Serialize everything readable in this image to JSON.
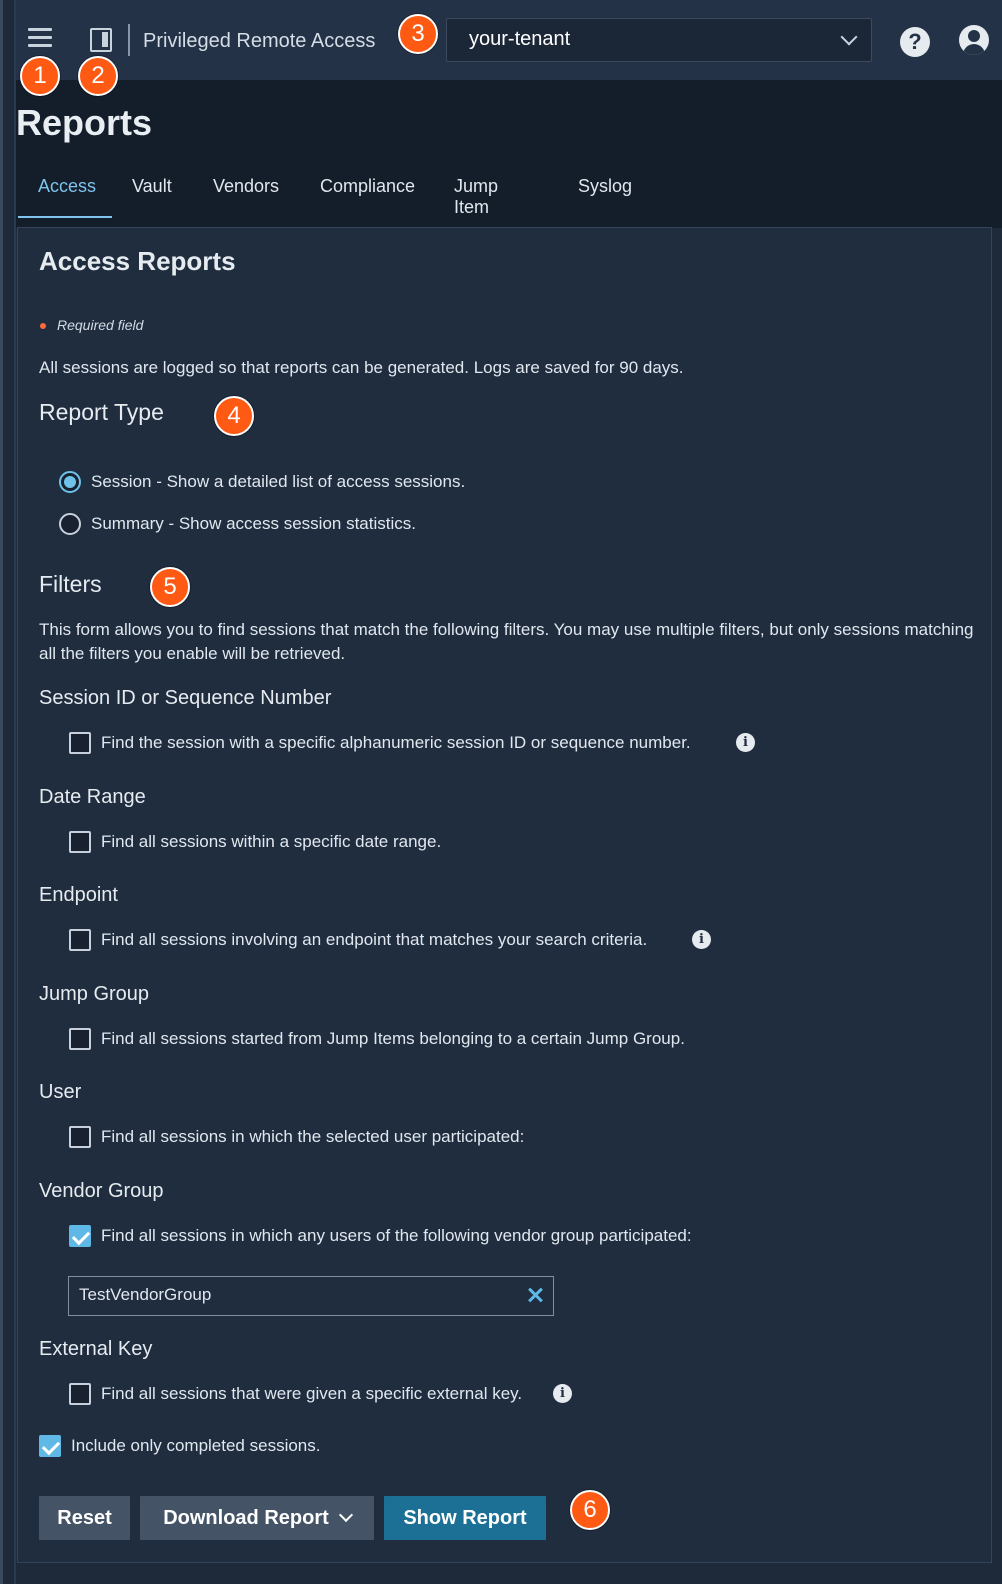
{
  "topbar": {
    "app_title": "Privileged Remote Access",
    "tenant": "your-tenant",
    "icons": [
      "menu-icon",
      "panel-icon",
      "chevron-down-icon",
      "help-icon",
      "user-icon"
    ]
  },
  "page": {
    "title": "Reports",
    "tabs": [
      {
        "label": "Access",
        "active": true
      },
      {
        "label": "Vault",
        "active": false
      },
      {
        "label": "Vendors",
        "active": false
      },
      {
        "label": "Compliance",
        "active": false
      },
      {
        "label": "Jump Item",
        "active": false
      },
      {
        "label": "Syslog",
        "active": false
      }
    ]
  },
  "form": {
    "heading": "Access Reports",
    "required_note": "Required field",
    "intro": "All sessions are logged so that reports can be generated. Logs are saved for 90 days.",
    "report_type": {
      "heading": "Report Type",
      "options": [
        {
          "label": "Session - Show a detailed list of access sessions.",
          "checked": true
        },
        {
          "label": "Summary - Show access session statistics.",
          "checked": false
        }
      ]
    },
    "filters": {
      "heading": "Filters",
      "description": "This form allows you to find sessions that match the following filters. You may use multiple filters, but only sessions matching all the filters you enable will be retrieved.",
      "groups": [
        {
          "title": "Session ID or Sequence Number",
          "label": "Find the session with a specific alphanumeric session ID or sequence number.",
          "checked": false,
          "info": true
        },
        {
          "title": "Date Range",
          "label": "Find all sessions within a specific date range.",
          "checked": false,
          "info": false
        },
        {
          "title": "Endpoint",
          "label": "Find all sessions involving an endpoint that matches your search criteria.",
          "checked": false,
          "info": true
        },
        {
          "title": "Jump Group",
          "label": "Find all sessions started from Jump Items belonging to a certain Jump Group.",
          "checked": false,
          "info": false
        },
        {
          "title": "User",
          "label": "Find all sessions in which the selected user participated:",
          "checked": false,
          "info": false
        },
        {
          "title": "Vendor Group",
          "label": "Find all sessions in which any users of the following vendor group participated:",
          "checked": true,
          "info": false,
          "value": "TestVendorGroup"
        },
        {
          "title": "External Key",
          "label": "Find all sessions that were given a specific external key.",
          "checked": false,
          "info": true
        }
      ],
      "completed_only": {
        "label": "Include only completed sessions.",
        "checked": true
      }
    },
    "buttons": {
      "reset": "Reset",
      "download": "Download Report",
      "show": "Show Report"
    }
  },
  "callouts": [
    "1",
    "2",
    "3",
    "4",
    "5",
    "6"
  ],
  "colors": {
    "accent": "#5fb8e6",
    "callout": "#ff5a14",
    "primary_button": "#1c6f95",
    "secondary_button": "#445466"
  }
}
